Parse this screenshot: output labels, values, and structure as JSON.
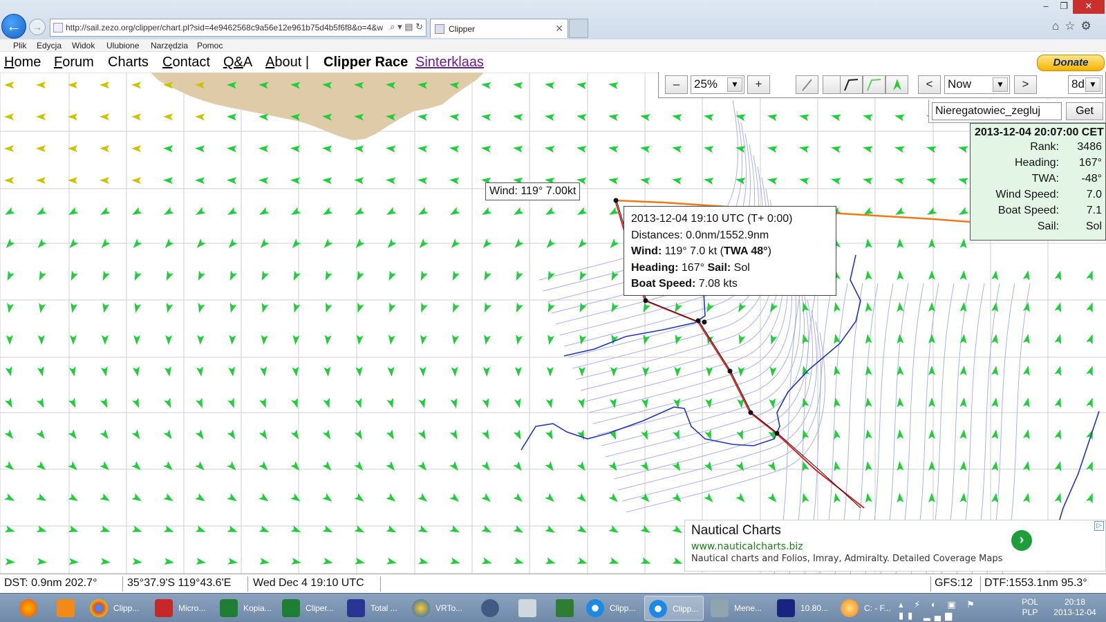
{
  "browser": {
    "url": "http://sail.zezo.org/clipper/chart.pl?sid=4e9462568c9a56e12e961b75d4b5f6f8&o=4&w",
    "tab_title": "Clipper",
    "address_tools": "⌕ ▾ ▤ ↻",
    "menu": [
      "Plik",
      "Edycja",
      "Widok",
      "Ulubione",
      "Narzędzia",
      "Pomoc"
    ]
  },
  "site_nav": {
    "home": "Home",
    "forum": "Forum",
    "charts": "Charts",
    "contact": "Contact",
    "qa": "Q&A",
    "about": "About |",
    "race": "Clipper Race",
    "race_link": "Sinterklaas",
    "donate": "Donate"
  },
  "toolbar": {
    "zoom_out": "–",
    "zoom": "25%",
    "zoom_in": "+",
    "prev": "<",
    "time": "Now",
    "next": ">",
    "range": "8d",
    "player": "Nieregatowiec_zegluj",
    "get": "Get"
  },
  "boat_panel": {
    "title": "2013-12-04 20:07:00 CET",
    "rows": [
      {
        "label": "Rank:",
        "value": "3486"
      },
      {
        "label": "Heading:",
        "value": "167°"
      },
      {
        "label": "TWA:",
        "value": "-48°"
      },
      {
        "label": "Wind Speed:",
        "value": "7.0"
      },
      {
        "label": "Boat Speed:",
        "value": "7.1"
      },
      {
        "label": "Sail:",
        "value": "Sol"
      }
    ]
  },
  "wind_tooltip": "Wind: 119° 7.00kt",
  "info_popup": {
    "time": "2013-12-04 19:10 UTC (T+ 0:00)",
    "distances": "Distances: 0.0nm/1552.9nm",
    "wind_label": "Wind:",
    "wind_value": " 119° 7.0 kt (",
    "twa": "TWA 48°",
    "wind_close": ")",
    "heading_label": "Heading:",
    "heading_value": " 167° ",
    "sail_label": "Sail:",
    "sail_value": " Sol",
    "boat_speed_label": "Boat Speed:",
    "boat_speed_value": " 7.08 kts"
  },
  "ad": {
    "title": "Nautical Charts",
    "url": "www.nauticalcharts.biz",
    "description": "Nautical charts and Folios, Imray, Admiralty. Detailed Coverage Maps",
    "arrow": "›",
    "choice": "▷"
  },
  "status_bar": {
    "dst": "DST:   0.9nm 202.7°",
    "position": "35°37.9'S  119°43.6'E",
    "time": "Wed Dec  4 19:10 UTC",
    "gfs": "GFS:12",
    "dtf": "DTF:1553.1nm  95.3°"
  },
  "taskbar": {
    "items": [
      "Clipp...",
      "Micro...",
      "Kopia...",
      "Cliper...",
      "Total ...",
      "VRTo...",
      "Clipp...",
      "Clipp...",
      "Mene...",
      "10.80...",
      "C: - F..."
    ],
    "tray": "▴ ⚡ ◐ ▣ ⚑ ▮▮ ▂▄▆",
    "lang": [
      "POL",
      "PLP"
    ],
    "clock_time": "20:18",
    "clock_date": "2013-12-04"
  },
  "colors": {
    "land": "#dfcba8",
    "arrow_yellow": "#c8c400",
    "arrow_green": "#1fcf3a",
    "isochrone": "#aab0ee",
    "isochrone_dark": "#2233bb",
    "route_red": "#e02020",
    "track_orange": "#f07818",
    "grid": "#cfcfcf",
    "panel_green": "#e3f6e6"
  }
}
